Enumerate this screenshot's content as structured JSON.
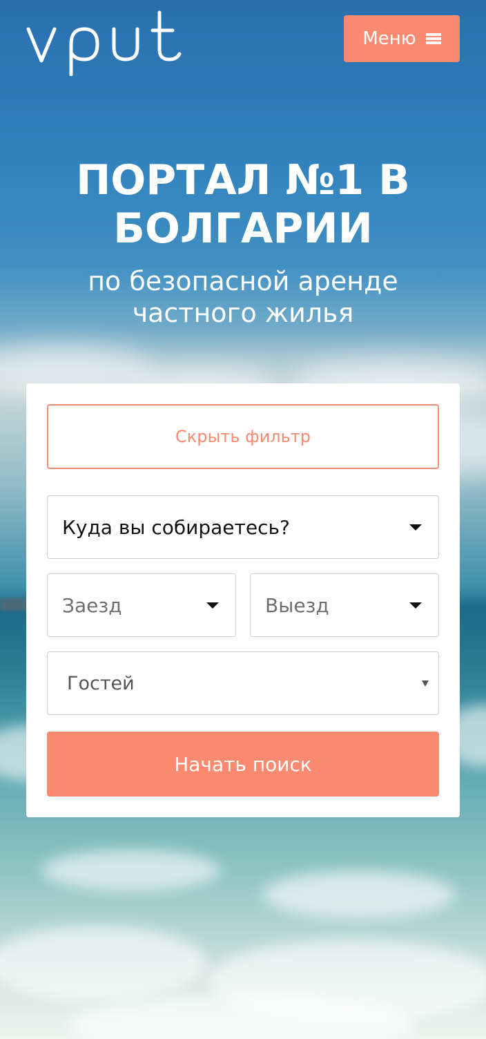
{
  "header": {
    "logo_text": "vput",
    "menu_label": "Меню",
    "menu_icon": "hamburger-icon"
  },
  "hero": {
    "title": "ПОРТАЛ №1 В БОЛГАРИИ",
    "subtitle": "по безопасной аренде частного жилья"
  },
  "filter": {
    "hide_label": "Скрыть фильтр",
    "destination_placeholder": "Куда вы собираетесь?",
    "checkin_placeholder": "Заезд",
    "checkout_placeholder": "Выезд",
    "guests_placeholder": "Гостей",
    "search_label": "Начать поиск",
    "dropdown_icon": "caret-down-icon"
  },
  "colors": {
    "accent": "#f98a70",
    "card_bg": "#ffffff",
    "field_border": "#cfcfcf"
  }
}
